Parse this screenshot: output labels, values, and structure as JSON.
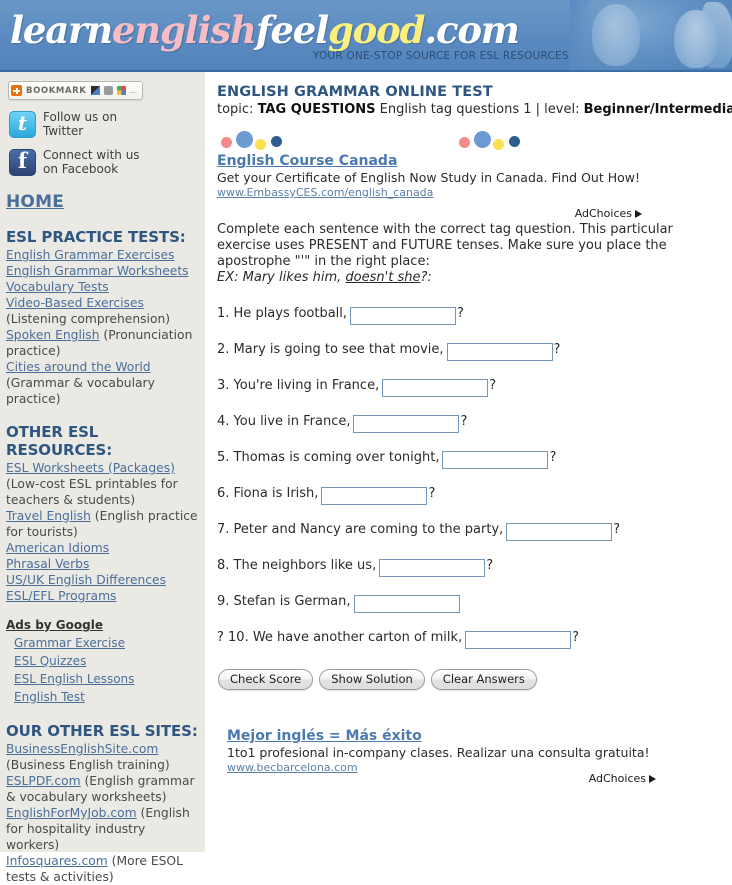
{
  "banner": {
    "logo_parts": [
      {
        "text": "learn",
        "color": "white"
      },
      {
        "text": "english",
        "color": "pink"
      },
      {
        "text": "feel",
        "color": "white"
      },
      {
        "text": "good",
        "color": "yellow"
      },
      {
        "text": ".com",
        "color": "white"
      }
    ],
    "tagline": "YOUR ONE-STOP SOURCE FOR ESL RESOURCES",
    "photo_alt": "two-women-smiling-photo"
  },
  "sidebar": {
    "bookmark": {
      "label": "BOOKMARK",
      "icons": [
        "bookmark-plus-icon",
        "share-square-icon",
        "gmail-icon",
        "windows-icon",
        "more-dots"
      ],
      "more": "..."
    },
    "social": [
      {
        "icon": "twitter-icon",
        "line1": "Follow us on",
        "line2": "Twitter"
      },
      {
        "icon": "facebook-icon",
        "line1": "Connect with us",
        "line2": "on Facebook"
      }
    ],
    "home_label": "HOME",
    "sections": [
      {
        "heading": "ESL PRACTICE TESTS:",
        "items": [
          {
            "link": "English Grammar Exercises",
            "note": ""
          },
          {
            "link": "English Grammar Worksheets",
            "note": ""
          },
          {
            "link": "Vocabulary Tests",
            "note": ""
          },
          {
            "link": "Video-Based Exercises",
            "note": " (Listening comprehension)"
          },
          {
            "link": "Spoken English",
            "note": " (Pronunciation practice)"
          },
          {
            "link": "Cities around the World",
            "note": " (Grammar & vocabulary practice)"
          }
        ]
      },
      {
        "heading": "OTHER ESL RESOURCES:",
        "items": [
          {
            "link": "ESL Worksheets (Packages)",
            "note": " (Low-cost ESL printables for teachers & students)"
          },
          {
            "link": "Travel English",
            "note": " (English practice for tourists)"
          },
          {
            "link": "American Idioms",
            "note": ""
          },
          {
            "link": "Phrasal Verbs",
            "note": ""
          },
          {
            "link": "US/UK English Differences",
            "note": ""
          },
          {
            "link": "ESL/EFL Programs",
            "note": ""
          }
        ]
      }
    ],
    "ads_by_google": {
      "label": "Ads by Google",
      "items": [
        "Grammar Exercise",
        "ESL Quizzes",
        "ESL English Lessons",
        "English Test"
      ]
    },
    "other_sites": {
      "heading": "OUR OTHER ESL SITES:",
      "items": [
        {
          "link": "BusinessEnglishSite.com",
          "note": " (Business English training)"
        },
        {
          "link": "ESLPDF.com",
          "note": " (English grammar & vocabulary worksheets)"
        },
        {
          "link": "EnglishForMyJob.com",
          "note": " (English for hospitality industry workers)"
        },
        {
          "link": "Infosquares.com",
          "note": " (More ESOL tests & activities)"
        }
      ]
    }
  },
  "content": {
    "page_title": "ENGLISH GRAMMAR ONLINE TEST",
    "topic": {
      "prefix": "topic: ",
      "topic_name": "TAG QUESTIONS",
      "middle": " English tag questions 1 | level: ",
      "level": "Beginner/Intermediate"
    },
    "top_ad": {
      "title": "English Course Canada",
      "desc": "Get your Certificate of English Now Study in Canada. Find Out How!",
      "url": "www.EmbassyCES.com/english_canada",
      "adchoices": "AdChoices"
    },
    "instructions": "Complete each sentence with the correct tag question. This particular exercise uses PRESENT and FUTURE tenses. Make sure you place the apostrophe \"'\" in the right place:",
    "example": {
      "prefix": "EX: Mary likes him, ",
      "underlined": "doesn't she",
      "suffix": "?:"
    },
    "questions": [
      {
        "text": "1. He plays football,",
        "input_value": "",
        "input_width": 100,
        "suffix": "?"
      },
      {
        "text": "2. Mary is going to see that movie,",
        "input_value": "",
        "input_width": 100,
        "suffix": "?"
      },
      {
        "text": "3. You're living in France,",
        "input_value": "",
        "input_width": 100,
        "suffix": "?"
      },
      {
        "text": "4. You live in France,",
        "input_value": "",
        "input_width": 100,
        "suffix": "?"
      },
      {
        "text": "5. Thomas is coming over tonight,",
        "input_value": "",
        "input_width": 100,
        "suffix": "?"
      },
      {
        "text": "6. Fiona is Irish,",
        "input_value": "",
        "input_width": 100,
        "suffix": "?"
      },
      {
        "text": "7. Peter and Nancy are coming to the party,",
        "input_value": "",
        "input_width": 100,
        "suffix": "?"
      },
      {
        "text": "8. The neighbors like us,",
        "input_value": "",
        "input_width": 100,
        "suffix": "?"
      },
      {
        "text": "9. Stefan is German,",
        "input_value": "",
        "input_width": 100,
        "suffix": ""
      },
      {
        "text": "? 10. We have another carton of milk,",
        "input_value": "",
        "input_width": 100,
        "suffix": "?"
      }
    ],
    "buttons": [
      {
        "label": "Check Score"
      },
      {
        "label": "Show Solution"
      },
      {
        "label": "Clear Answers"
      }
    ],
    "bottom_ad": {
      "title": "Mejor inglés = Más éxito",
      "desc": "1to1 profesional in-company clases. Realizar una consulta gratuita!",
      "url": "www.becbarcelona.com",
      "adchoices": "AdChoices"
    }
  },
  "colors": {
    "banner_blue": "#5a8ac0",
    "sidebar_bg": "#ebe9e4",
    "heading_blue": "#2f5680",
    "link_blue": "#4a6f9b",
    "ad_title_blue": "#4a7ab0",
    "input_border": "#7595b8",
    "dot_pink": "#f58a8a",
    "dot_blue": "#6b9bd2",
    "dot_yellow": "#fbe14f",
    "dot_navy": "#2f5e8e"
  }
}
